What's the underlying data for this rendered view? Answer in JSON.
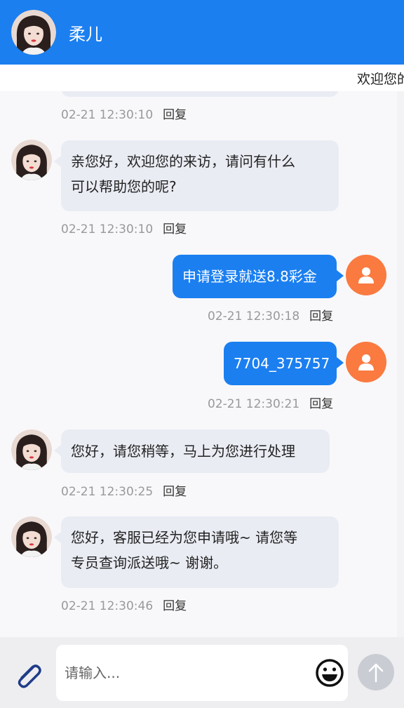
{
  "header": {
    "name": "柔儿"
  },
  "notice": {
    "text": "欢迎您的"
  },
  "messages": [
    {
      "side": "left",
      "time": "02-21 12:30:10",
      "reply": "回复"
    },
    {
      "side": "left",
      "line1": "亲您好，欢迎您的来访，请问有什么",
      "line2": "可以帮助您的呢?",
      "time": "02-21 12:30:10",
      "reply": "回复"
    },
    {
      "side": "right",
      "text": "申请登录就送8.8彩金",
      "time": "02-21 12:30:18",
      "reply": "回复"
    },
    {
      "side": "right",
      "text": "7704_375757",
      "time": "02-21 12:30:21",
      "reply": "回复"
    },
    {
      "side": "left",
      "text": "您好，请您稍等，马上为您进行处理",
      "time": "02-21 12:30:25",
      "reply": "回复"
    },
    {
      "side": "left",
      "line1": "您好，客服已经为您申请哦~ 请您等",
      "line2": "专员查询派送哦~ 谢谢。",
      "time": "02-21 12:30:46",
      "reply": "回复"
    }
  ],
  "composer": {
    "placeholder": "请输入..."
  },
  "colors": {
    "primary": "#1b7ff0",
    "user_avatar": "#fa7a40",
    "bubble_agent": "#e9ecf3"
  },
  "icons": [
    "agent-avatar-photo",
    "user-icon",
    "paperclip-icon",
    "smiley-icon",
    "arrow-up-icon"
  ]
}
